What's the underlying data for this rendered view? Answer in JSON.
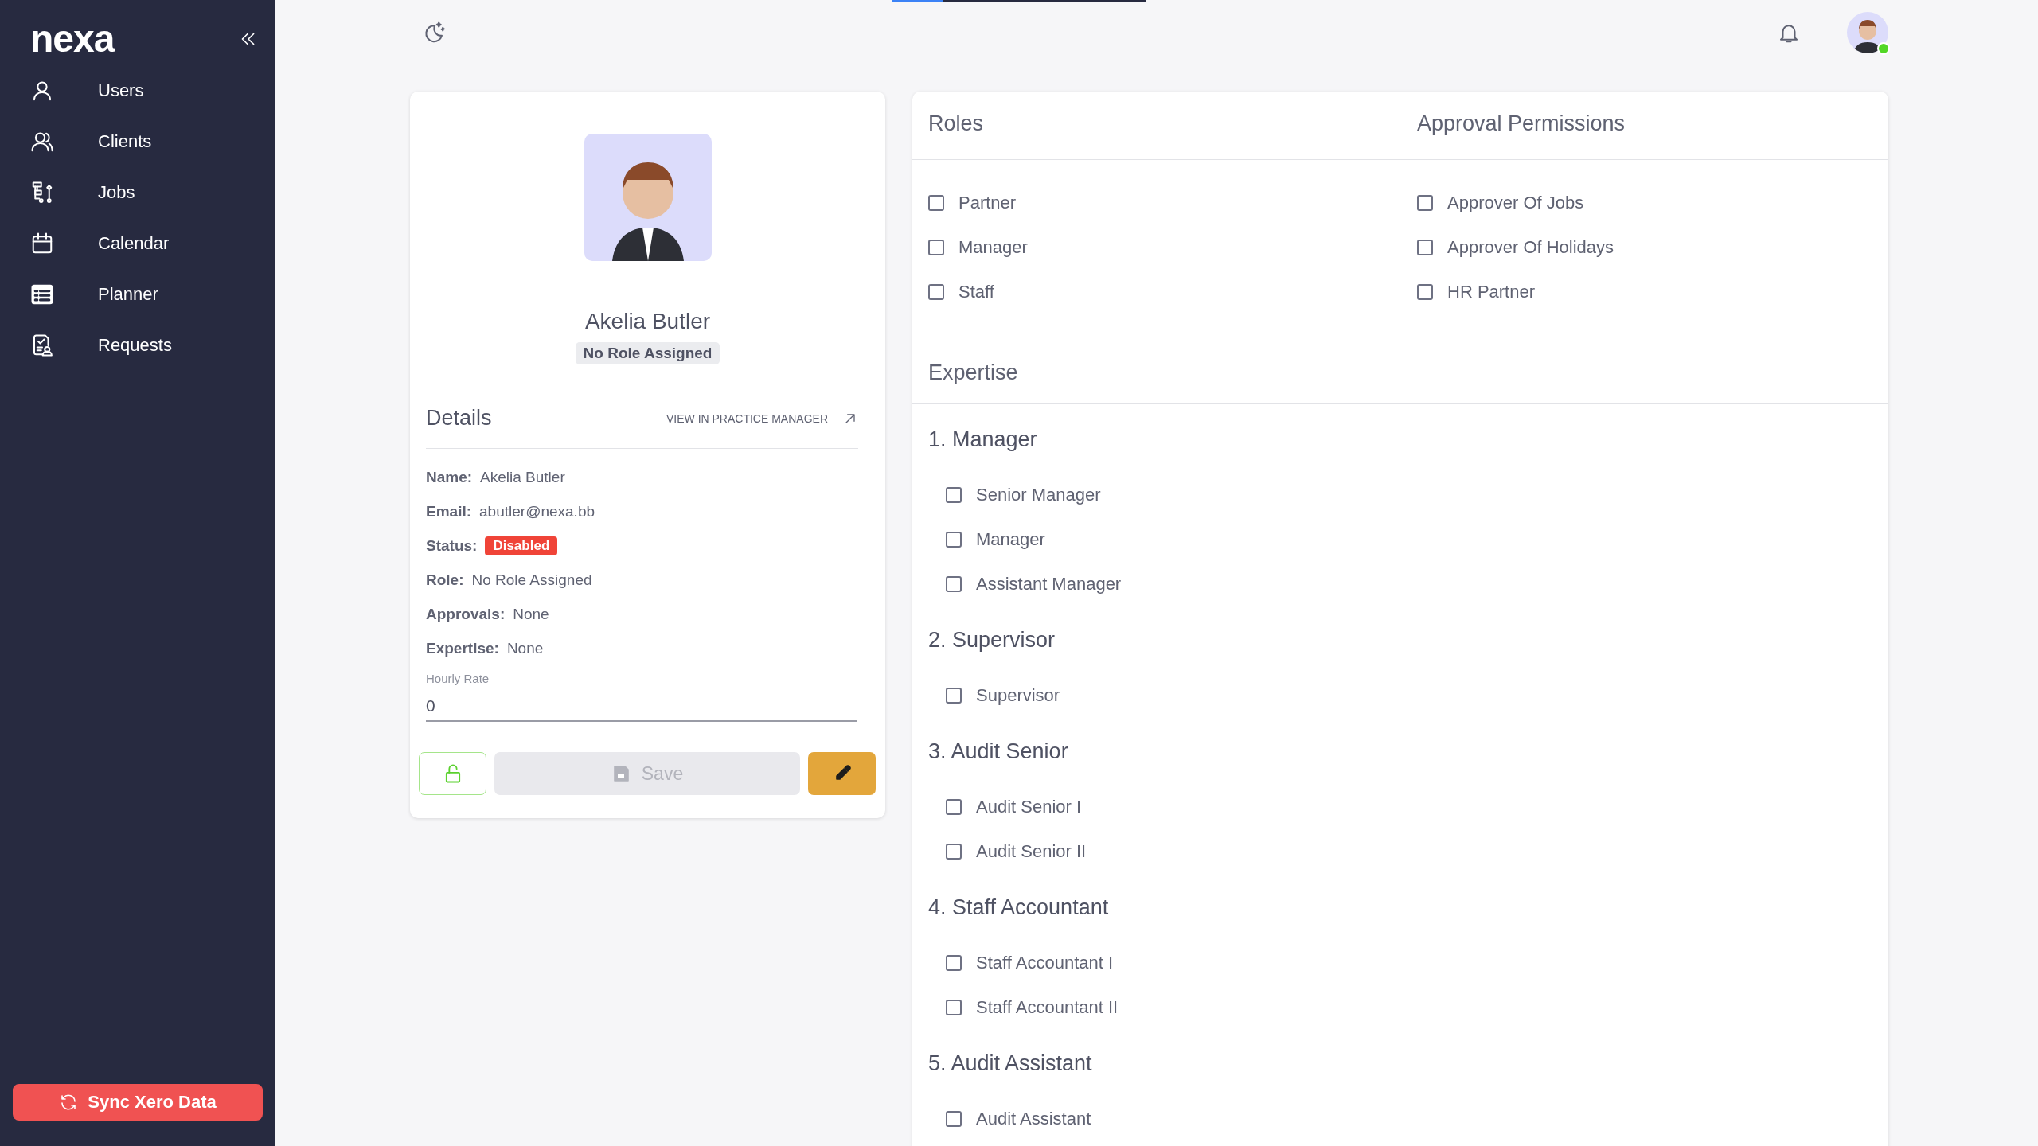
{
  "sidebar": {
    "logo": "nexa",
    "items": [
      {
        "label": "Users"
      },
      {
        "label": "Clients"
      },
      {
        "label": "Jobs"
      },
      {
        "label": "Calendar"
      },
      {
        "label": "Planner"
      },
      {
        "label": "Requests"
      }
    ],
    "sync_button": "Sync Xero Data"
  },
  "top_bar": {
    "progress": {
      "level": 0.2
    },
    "user_online": true
  },
  "profile": {
    "name": "Akelia Butler",
    "role_badge": "No Role Assigned",
    "details_title": "Details",
    "external_link": "VIEW IN PRACTICE MANAGER",
    "fields": [
      {
        "label": "Name:",
        "value": "Akelia Butler",
        "kind": "text"
      },
      {
        "label": "Email:",
        "value": "abutler@nexa.bb",
        "kind": "text"
      },
      {
        "label": "Status:",
        "value": "Disabled",
        "kind": "badge"
      },
      {
        "label": "Role:",
        "value": "No Role Assigned",
        "kind": "text"
      },
      {
        "label": "Approvals:",
        "value": "None",
        "kind": "text"
      },
      {
        "label": "Expertise:",
        "value": "None",
        "kind": "text"
      }
    ],
    "hourly_rate": {
      "label": "Hourly Rate",
      "value": "0"
    },
    "save_button": {
      "label": "Save",
      "disabled": true
    }
  },
  "roles": {
    "title": "Roles",
    "options": [
      {
        "label": "Partner",
        "checked": false
      },
      {
        "label": "Manager",
        "checked": false
      },
      {
        "label": "Staff",
        "checked": false
      }
    ]
  },
  "approvals": {
    "title": "Approval Permissions",
    "options": [
      {
        "label": "Approver Of Jobs",
        "checked": false
      },
      {
        "label": "Approver Of Holidays",
        "checked": false
      },
      {
        "label": "HR Partner",
        "checked": false
      }
    ]
  },
  "expertise": {
    "title": "Expertise",
    "groups": [
      {
        "title": "1. Manager",
        "options": [
          {
            "label": "Senior Manager",
            "checked": false
          },
          {
            "label": "Manager",
            "checked": false
          },
          {
            "label": "Assistant Manager",
            "checked": false
          }
        ]
      },
      {
        "title": "2. Supervisor",
        "options": [
          {
            "label": "Supervisor",
            "checked": false
          }
        ]
      },
      {
        "title": "3. Audit Senior",
        "options": [
          {
            "label": "Audit Senior I",
            "checked": false
          },
          {
            "label": "Audit Senior II",
            "checked": false
          }
        ]
      },
      {
        "title": "4. Staff Accountant",
        "options": [
          {
            "label": "Staff Accountant I",
            "checked": false
          },
          {
            "label": "Staff Accountant II",
            "checked": false
          }
        ]
      },
      {
        "title": "5. Audit Assistant",
        "options": [
          {
            "label": "Audit Assistant",
            "checked": false
          }
        ]
      }
    ]
  }
}
